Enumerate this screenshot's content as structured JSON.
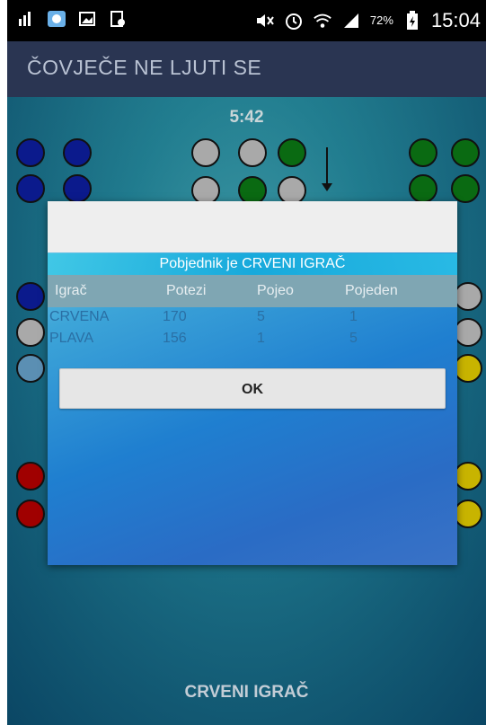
{
  "status_bar": {
    "battery": "72%",
    "time": "15:04",
    "icons": [
      "signal-bars-icon",
      "photo-icon",
      "gallery-icon",
      "screenshot-icon",
      "mute-icon",
      "alarm-icon",
      "wifi-icon",
      "cell-signal-icon",
      "battery-icon"
    ]
  },
  "app_bar": {
    "title": "ČOVJEČE NE LJUTI SE"
  },
  "game": {
    "timer": "5:42",
    "current_player": "CRVENI IGRAČ",
    "colors": {
      "blue": "#0b1a8c",
      "green": "#0a6a12",
      "red": "#a00000",
      "yellow": "#c8b400",
      "empty": "#a9a9a9",
      "background": "#0f6f86"
    }
  },
  "dialog": {
    "title": "Pobjednik je CRVENI IGRAČ",
    "columns": [
      "Igrač",
      "Potezi",
      "Pojeo",
      "Pojeden"
    ],
    "rows": [
      {
        "player": "CRVENA",
        "moves": "170",
        "ate": "5",
        "eaten": "1"
      },
      {
        "player": "PLAVA",
        "moves": "156",
        "ate": "1",
        "eaten": "5"
      }
    ],
    "ok_label": "OK"
  }
}
